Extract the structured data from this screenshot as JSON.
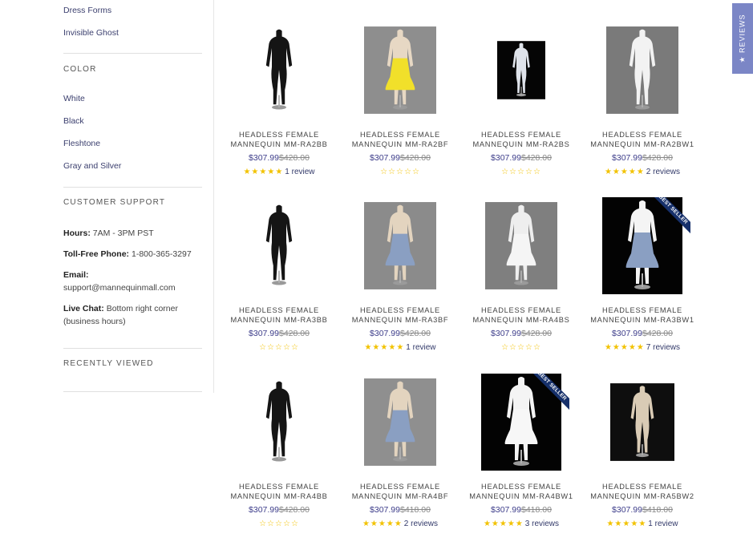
{
  "sidebar": {
    "style_links": [
      "Dress Forms",
      "Invisible Ghost"
    ],
    "color_heading": "COLOR",
    "color_links": [
      "White",
      "Black",
      "Fleshtone",
      "Gray and Silver"
    ],
    "support_heading": "CUSTOMER SUPPORT",
    "support": {
      "hours_label": "Hours:",
      "hours_value": "7AM - 3PM PST",
      "phone_label": "Toll-Free Phone:",
      "phone_value": "1-800-365-3297",
      "email_label": "Email:",
      "email_value": "support@mannequinmall.com",
      "chat_label": "Live Chat:",
      "chat_value": "Bottom right corner (business hours)"
    },
    "recent_heading": "RECENTLY VIEWED"
  },
  "reviews_tab": "★ REVIEWS",
  "products": [
    {
      "title": "HEADLESS FEMALE MANNEQUIN MM-RA2BB",
      "sale": "$307.99",
      "old": "$428.00",
      "rating": 5,
      "reviews": "1 review",
      "badge": ""
    },
    {
      "title": "HEADLESS FEMALE MANNEQUIN MM-RA2BF",
      "sale": "$307.99",
      "old": "$428.00",
      "rating": 0,
      "reviews": "",
      "badge": ""
    },
    {
      "title": "HEADLESS FEMALE MANNEQUIN MM-RA2BS",
      "sale": "$307.99",
      "old": "$428.00",
      "rating": 0,
      "reviews": "",
      "badge": ""
    },
    {
      "title": "HEADLESS FEMALE MANNEQUIN MM-RA2BW1",
      "sale": "$307.99",
      "old": "$428.00",
      "rating": 4.5,
      "reviews": "2 reviews",
      "badge": ""
    },
    {
      "title": "HEADLESS FEMALE MANNEQUIN MM-RA3BB",
      "sale": "$307.99",
      "old": "$428.00",
      "rating": 0,
      "reviews": "",
      "badge": ""
    },
    {
      "title": "HEADLESS FEMALE MANNEQUIN MM-RA3BF",
      "sale": "$307.99",
      "old": "$428.00",
      "rating": 5,
      "reviews": "1 review",
      "badge": ""
    },
    {
      "title": "HEADLESS FEMALE MANNEQUIN MM-RA4BS",
      "sale": "$307.99",
      "old": "$428.00",
      "rating": 0,
      "reviews": "",
      "badge": ""
    },
    {
      "title": "HEADLESS FEMALE MANNEQUIN MM-RA3BW1",
      "sale": "$307.99",
      "old": "$428.00",
      "rating": 5,
      "reviews": "7 reviews",
      "badge": "BEST SELLER"
    },
    {
      "title": "HEADLESS FEMALE MANNEQUIN MM-RA4BB",
      "sale": "$307.99",
      "old": "$428.00",
      "rating": 0,
      "reviews": "",
      "badge": ""
    },
    {
      "title": "HEADLESS FEMALE MANNEQUIN MM-RA4BF",
      "sale": "$307.99",
      "old": "$418.00",
      "rating": 5,
      "reviews": "2 reviews",
      "badge": ""
    },
    {
      "title": "HEADLESS FEMALE MANNEQUIN MM-RA4BW1",
      "sale": "$307.99",
      "old": "$418.00",
      "rating": 5,
      "reviews": "3 reviews",
      "badge": "BEST SELLER"
    },
    {
      "title": "HEADLESS FEMALE MANNEQUIN MM-RA5BW2",
      "sale": "$307.99",
      "old": "$418.00",
      "rating": 5,
      "reviews": "1 review",
      "badge": ""
    }
  ],
  "colors": {
    "link": "#3b3f6e",
    "sale_price": "#3d3d8a",
    "star": "#f2c200",
    "badge": "#16306b",
    "reviews_tab": "#7b86c6"
  }
}
